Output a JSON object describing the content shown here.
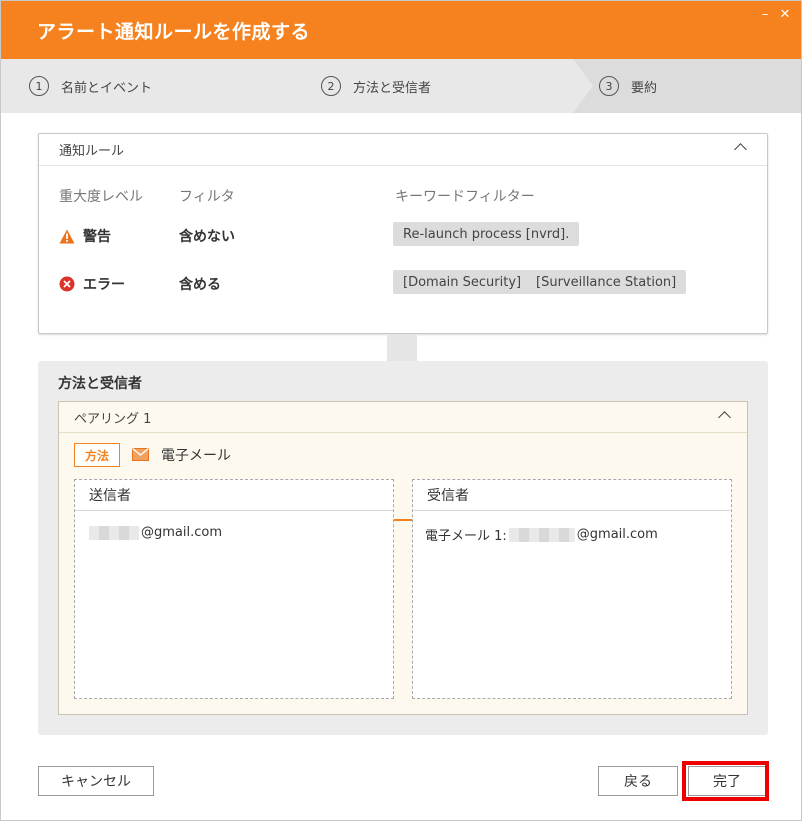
{
  "window": {
    "title": "アラート通知ルールを作成する",
    "minimize_glyph": "–",
    "close_glyph": "✕"
  },
  "steps": [
    {
      "number": "1",
      "label": "名前とイベント"
    },
    {
      "number": "2",
      "label": "方法と受信者"
    },
    {
      "number": "3",
      "label": "要約"
    }
  ],
  "rule_section": {
    "title": "通知ルール",
    "columns": {
      "severity": "重大度レベル",
      "filter": "フィルタ",
      "keyword": "キーワードフィルター"
    },
    "rows": [
      {
        "severity_icon": "warning-icon",
        "severity": "警告",
        "filter": "含めない",
        "keywords": [
          "Re-launch process [nvrd]."
        ]
      },
      {
        "severity_icon": "error-icon",
        "severity": "エラー",
        "filter": "含める",
        "keywords": [
          "[Domain Security]",
          "[Surveillance Station]"
        ]
      }
    ]
  },
  "method_section": {
    "title": "方法と受信者",
    "pairing": {
      "title": "ペアリング 1",
      "method_badge": "方法",
      "method_icon": "mail-icon",
      "method_label": "電子メール",
      "sender": {
        "title": "送信者",
        "email_suffix": "@gmail.com"
      },
      "recipient": {
        "title": "受信者",
        "prefix": "電子メール 1:",
        "email_suffix": "@gmail.com"
      }
    }
  },
  "footer": {
    "cancel": "キャンセル",
    "back": "戻る",
    "done": "完了"
  },
  "colors": {
    "accent": "#f5821f",
    "highlight": "#ee0000",
    "warning": "#e8731c",
    "error": "#d9342b"
  }
}
